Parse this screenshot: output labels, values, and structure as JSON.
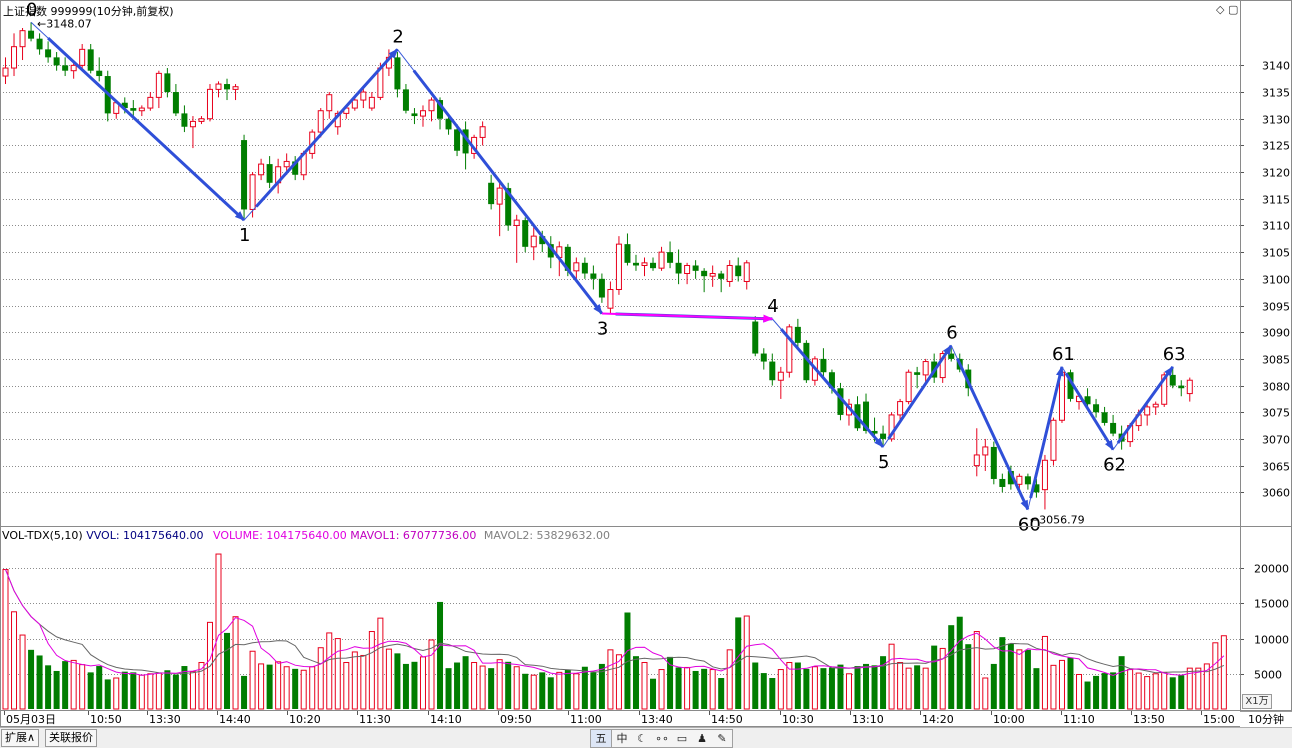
{
  "title": "上证指数 999999(10分钟,前复权)",
  "window_icons": "◇ ▢",
  "volume_header": {
    "name": "VOL-TDX(5,10)",
    "vvol": "VVOL: 104175640.00",
    "volume": "VOLUME: 104175640.00",
    "mavol1": "MAVOL1: 67077736.00",
    "mavol2": "MAVOL2: 53829632.00"
  },
  "bottom_tabs": [
    "扩展∧",
    "关联报价"
  ],
  "toolbar_icons": [
    "五",
    "中",
    "moon-icon",
    "glasses-icon",
    "keyboard-icon",
    "user-icon",
    "wrench-icon"
  ],
  "toolbar_labels": [
    "五",
    "中",
    "☾",
    "∘∘",
    "▭",
    "♟",
    "✎"
  ],
  "period_label": "10分钟",
  "zoom_label": "X1万",
  "colors": {
    "up": "#e8001c",
    "down": "#007d00",
    "wave": "#3a5bd9",
    "wave_arrow": "#2f4fd8",
    "magenta": "#ff00ff",
    "grid": "#8c8c8c",
    "ma1": "#e100e1",
    "ma2": "#666666"
  },
  "chart_data": [
    {
      "type": "candlestick",
      "title": "上证指数 999999(10分钟,前复权)",
      "price_axis": {
        "ticks": [
          3060,
          3065,
          3070,
          3075,
          3080,
          3085,
          3090,
          3095,
          3100,
          3105,
          3110,
          3115,
          3120,
          3125,
          3130,
          3135,
          3140
        ],
        "range": [
          3053.5,
          3148.5
        ]
      },
      "time_axis_labels": [
        "05月03日",
        "10:50",
        "13:30",
        "14:40",
        "10:20",
        "11:30",
        "14:10",
        "09:50",
        "11:00",
        "13:40",
        "14:50",
        "10:30",
        "13:10",
        "14:20",
        "10:00",
        "11:10",
        "13:50",
        "15:00"
      ],
      "max_marker": {
        "label": "3148.07",
        "value": 3148.07
      },
      "min_marker": {
        "label": "3056.79",
        "value": 3056.79
      },
      "candles": [
        [
          3138.0,
          3141.5,
          3136.5,
          3139.5
        ],
        [
          3139.5,
          3146.0,
          3138.0,
          3143.5
        ],
        [
          3143.5,
          3147.0,
          3141.0,
          3146.5
        ],
        [
          3146.5,
          3148.07,
          3144.5,
          3145.0
        ],
        [
          3145.0,
          3146.0,
          3142.0,
          3143.0
        ],
        [
          3143.0,
          3144.5,
          3140.5,
          3141.5
        ],
        [
          3141.5,
          3142.5,
          3139.0,
          3140.0
        ],
        [
          3140.0,
          3141.5,
          3138.0,
          3139.0
        ],
        [
          3139.0,
          3140.5,
          3137.5,
          3140.0
        ],
        [
          3140.0,
          3144.0,
          3139.0,
          3143.0
        ],
        [
          3143.0,
          3144.0,
          3138.5,
          3139.0
        ],
        [
          3139.0,
          3141.5,
          3137.0,
          3138.0
        ],
        [
          3138.0,
          3139.0,
          3129.5,
          3131.0
        ],
        [
          3131.0,
          3133.5,
          3130.0,
          3133.0
        ],
        [
          3133.0,
          3134.0,
          3131.0,
          3132.0
        ],
        [
          3132.0,
          3133.5,
          3130.5,
          3131.5
        ],
        [
          3131.5,
          3132.5,
          3130.5,
          3132.0
        ],
        [
          3132.0,
          3135.0,
          3131.5,
          3134.0
        ],
        [
          3134.0,
          3139.0,
          3132.0,
          3138.5
        ],
        [
          3138.5,
          3139.5,
          3134.0,
          3135.0
        ],
        [
          3135.0,
          3136.5,
          3130.5,
          3131.0
        ],
        [
          3131.0,
          3132.5,
          3127.5,
          3128.5
        ],
        [
          3128.5,
          3130.5,
          3124.5,
          3129.5
        ],
        [
          3129.5,
          3130.5,
          3129.0,
          3130.0
        ],
        [
          3130.0,
          3136.5,
          3129.5,
          3135.5
        ],
        [
          3135.5,
          3137.0,
          3134.0,
          3136.5
        ],
        [
          3136.5,
          3137.5,
          3133.5,
          3135.5
        ],
        [
          3135.5,
          3136.5,
          3133.5,
          3136.0
        ],
        [
          3126.0,
          3127.0,
          3111.0,
          3113.0
        ],
        [
          3113.0,
          3120.0,
          3111.5,
          3119.5
        ],
        [
          3119.5,
          3122.5,
          3118.5,
          3121.5
        ],
        [
          3121.5,
          3123.0,
          3117.0,
          3118.0
        ],
        [
          3118.0,
          3122.5,
          3116.0,
          3121.0
        ],
        [
          3121.0,
          3123.5,
          3119.5,
          3122.0
        ],
        [
          3122.0,
          3123.0,
          3118.5,
          3119.5
        ],
        [
          3119.5,
          3124.0,
          3118.5,
          3123.5
        ],
        [
          3123.5,
          3128.0,
          3122.5,
          3127.5
        ],
        [
          3127.5,
          3132.0,
          3126.5,
          3131.5
        ],
        [
          3131.5,
          3135.0,
          3130.0,
          3134.5
        ],
        [
          3128.5,
          3131.5,
          3127.0,
          3131.0
        ],
        [
          3131.0,
          3132.5,
          3130.0,
          3132.0
        ],
        [
          3132.0,
          3134.0,
          3131.5,
          3133.5
        ],
        [
          3133.5,
          3136.0,
          3132.0,
          3135.0
        ],
        [
          3132.0,
          3135.0,
          3131.5,
          3134.0
        ],
        [
          3134.0,
          3140.5,
          3133.5,
          3139.5
        ],
        [
          3139.5,
          3143.0,
          3138.0,
          3141.5
        ],
        [
          3141.5,
          3142.5,
          3134.0,
          3135.5
        ],
        [
          3135.5,
          3136.5,
          3131.0,
          3131.5
        ],
        [
          3131.0,
          3132.0,
          3129.0,
          3130.5
        ],
        [
          3130.5,
          3132.5,
          3128.5,
          3131.5
        ],
        [
          3131.5,
          3134.0,
          3129.5,
          3133.5
        ],
        [
          3133.5,
          3134.0,
          3128.0,
          3130.0
        ],
        [
          3130.0,
          3130.5,
          3127.0,
          3128.0
        ],
        [
          3128.0,
          3129.0,
          3123.0,
          3124.0
        ],
        [
          3128.0,
          3129.5,
          3120.5,
          3123.5
        ],
        [
          3123.5,
          3127.0,
          3122.5,
          3126.5
        ],
        [
          3126.5,
          3129.5,
          3125.0,
          3128.5
        ],
        [
          3118.0,
          3119.5,
          3113.0,
          3114.0
        ],
        [
          3114.0,
          3118.0,
          3108.0,
          3117.0
        ],
        [
          3117.0,
          3118.0,
          3109.0,
          3110.0
        ],
        [
          3110.0,
          3112.0,
          3103.0,
          3111.0
        ],
        [
          3111.0,
          3111.5,
          3105.0,
          3106.0
        ],
        [
          3106.0,
          3110.0,
          3103.5,
          3108.0
        ],
        [
          3108.0,
          3109.0,
          3105.0,
          3106.5
        ],
        [
          3106.5,
          3108.0,
          3102.0,
          3104.0
        ],
        [
          3104.0,
          3107.0,
          3100.5,
          3106.0
        ],
        [
          3106.0,
          3106.5,
          3100.5,
          3101.5
        ],
        [
          3101.5,
          3104.0,
          3099.5,
          3103.0
        ],
        [
          3103.0,
          3104.0,
          3100.0,
          3101.0
        ],
        [
          3101.0,
          3102.5,
          3098.0,
          3100.0
        ],
        [
          3100.0,
          3101.0,
          3095.5,
          3096.5
        ],
        [
          3094.5,
          3099.5,
          3093.5,
          3098.0
        ],
        [
          3098.0,
          3108.0,
          3097.0,
          3106.5
        ],
        [
          3106.5,
          3108.5,
          3102.5,
          3103.0
        ],
        [
          3103.0,
          3104.5,
          3101.5,
          3102.5
        ],
        [
          3102.5,
          3104.0,
          3100.5,
          3103.0
        ],
        [
          3103.0,
          3104.0,
          3101.5,
          3102.0
        ],
        [
          3102.0,
          3106.0,
          3101.5,
          3105.0
        ],
        [
          3105.0,
          3107.0,
          3102.0,
          3103.0
        ],
        [
          3103.0,
          3105.5,
          3099.0,
          3101.0
        ],
        [
          3101.0,
          3103.0,
          3099.0,
          3102.5
        ],
        [
          3102.5,
          3103.5,
          3100.0,
          3101.5
        ],
        [
          3101.5,
          3102.0,
          3097.5,
          3100.5
        ],
        [
          3100.5,
          3102.5,
          3098.5,
          3101.0
        ],
        [
          3101.0,
          3101.5,
          3097.5,
          3100.0
        ],
        [
          3099.5,
          3103.5,
          3098.5,
          3102.5
        ],
        [
          3102.5,
          3104.0,
          3099.5,
          3100.5
        ],
        [
          3099.5,
          3103.5,
          3098.0,
          3103.0
        ],
        [
          3092.0,
          3093.0,
          3085.5,
          3086.0
        ],
        [
          3086.0,
          3087.0,
          3083.0,
          3084.5
        ],
        [
          3084.5,
          3086.0,
          3080.0,
          3081.0
        ],
        [
          3081.0,
          3083.5,
          3077.5,
          3082.5
        ],
        [
          3082.5,
          3091.5,
          3081.5,
          3091.0
        ],
        [
          3091.0,
          3092.5,
          3087.0,
          3088.0
        ],
        [
          3088.0,
          3088.5,
          3080.5,
          3081.0
        ],
        [
          3081.0,
          3085.5,
          3080.0,
          3085.0
        ],
        [
          3085.0,
          3087.0,
          3081.5,
          3082.5
        ],
        [
          3082.5,
          3083.0,
          3078.5,
          3079.5
        ],
        [
          3079.5,
          3080.5,
          3073.5,
          3074.5
        ],
        [
          3074.5,
          3077.5,
          3072.5,
          3076.5
        ],
        [
          3076.5,
          3078.0,
          3071.5,
          3072.0
        ],
        [
          3077.0,
          3078.5,
          3071.0,
          3071.5
        ],
        [
          3071.5,
          3074.0,
          3069.5,
          3071.0
        ],
        [
          3071.0,
          3072.5,
          3068.5,
          3070.0
        ],
        [
          3070.0,
          3075.0,
          3069.5,
          3074.5
        ],
        [
          3074.5,
          3077.5,
          3073.5,
          3077.0
        ],
        [
          3077.0,
          3083.0,
          3076.5,
          3082.5
        ],
        [
          3082.5,
          3083.5,
          3079.5,
          3082.0
        ],
        [
          3082.0,
          3085.0,
          3080.5,
          3084.5
        ],
        [
          3084.5,
          3086.0,
          3080.5,
          3081.5
        ],
        [
          3081.5,
          3086.5,
          3080.5,
          3086.0
        ],
        [
          3086.0,
          3087.5,
          3084.5,
          3085.0
        ],
        [
          3085.0,
          3086.0,
          3082.5,
          3083.0
        ],
        [
          3083.0,
          3084.0,
          3078.0,
          3079.5
        ],
        [
          3065.0,
          3072.0,
          3063.0,
          3067.0
        ],
        [
          3067.0,
          3070.0,
          3064.0,
          3068.5
        ],
        [
          3068.5,
          3069.5,
          3061.5,
          3062.5
        ],
        [
          3062.5,
          3063.5,
          3060.0,
          3061.0
        ],
        [
          3064.0,
          3065.0,
          3060.5,
          3061.5
        ],
        [
          3061.5,
          3063.5,
          3060.0,
          3063.0
        ],
        [
          3063.0,
          3063.5,
          3060.5,
          3061.5
        ],
        [
          3061.5,
          3062.5,
          3059.0,
          3060.0
        ],
        [
          3060.5,
          3067.0,
          3056.79,
          3066.0
        ],
        [
          3066.0,
          3074.0,
          3065.0,
          3073.5
        ],
        [
          3073.5,
          3083.5,
          3073.0,
          3082.5
        ],
        [
          3082.5,
          3083.0,
          3077.0,
          3077.5
        ],
        [
          3077.0,
          3078.5,
          3075.5,
          3078.0
        ],
        [
          3078.0,
          3079.5,
          3075.5,
          3076.5
        ],
        [
          3076.5,
          3077.5,
          3074.0,
          3075.0
        ],
        [
          3075.0,
          3076.0,
          3072.5,
          3073.0
        ],
        [
          3073.0,
          3074.5,
          3070.5,
          3071.0
        ],
        [
          3071.0,
          3072.5,
          3068.0,
          3069.5
        ],
        [
          3069.5,
          3073.0,
          3068.5,
          3072.5
        ],
        [
          3072.5,
          3075.5,
          3071.5,
          3074.5
        ],
        [
          3074.5,
          3076.5,
          3072.5,
          3076.0
        ],
        [
          3076.0,
          3077.0,
          3074.5,
          3076.5
        ],
        [
          3076.5,
          3082.5,
          3076.0,
          3082.0
        ],
        [
          3082.0,
          3083.5,
          3079.5,
          3080.0
        ],
        [
          3080.0,
          3081.0,
          3078.0,
          3079.5
        ],
        [
          3078.5,
          3081.5,
          3077.0,
          3081.0
        ]
      ],
      "waves": [
        {
          "label": "0",
          "value": 3148.07
        },
        {
          "label": "1",
          "value": 3111.0
        },
        {
          "label": "2",
          "value": 3143.0
        },
        {
          "label": "3",
          "value": 3093.5
        },
        {
          "label": "4",
          "value": 3092.5
        },
        {
          "label": "5",
          "value": 3068.5
        },
        {
          "label": "6",
          "value": 3087.5
        },
        {
          "label": "60",
          "value": 3056.79
        },
        {
          "label": "61",
          "value": 3083.5
        },
        {
          "label": "62",
          "value": 3068.0
        },
        {
          "label": "63",
          "value": 3083.5
        }
      ]
    },
    {
      "type": "bar",
      "title": "VOL-TDX(5,10)",
      "y_axis": {
        "ticks": [
          5000,
          10000,
          15000,
          20000
        ],
        "unit_label": "X1万",
        "range": [
          0,
          23000
        ]
      },
      "series": [
        {
          "name": "VOLUME",
          "values": [
            19800,
            13800,
            10500,
            8400,
            7600,
            6200,
            5400,
            6800,
            6900,
            6300,
            5200,
            6100,
            4200,
            4400,
            5300,
            5200,
            4800,
            5000,
            5100,
            5500,
            4900,
            6100,
            5300,
            6600,
            12300,
            22000,
            10800,
            13100,
            4700,
            8200,
            6400,
            6300,
            6700,
            6000,
            5700,
            5500,
            6000,
            8700,
            10800,
            10000,
            6600,
            8100,
            7600,
            11000,
            12900,
            8500,
            7900,
            6400,
            6700,
            7400,
            9800,
            15200,
            5800,
            6600,
            7500,
            6600,
            6100,
            5800,
            7000,
            6700,
            6000,
            5000,
            4800,
            5200,
            4500,
            5200,
            5600,
            5000,
            6000,
            5200,
            6400,
            8400,
            7700,
            13700,
            7500,
            6600,
            4300,
            5600,
            7400,
            5900,
            5900,
            5400,
            5700,
            5600,
            4400,
            8400,
            13000,
            13200,
            6600,
            5100,
            4400,
            5600,
            6600,
            6600,
            5700,
            6000,
            5800,
            5900,
            6300,
            5000,
            6100,
            6400,
            6200,
            7500,
            9200,
            6600,
            5800,
            6200,
            5800,
            9000,
            8600,
            11900,
            13100,
            9200,
            11000,
            4400,
            6400,
            10200,
            9300,
            8400,
            8400,
            5800,
            10300,
            6200,
            6900,
            7300,
            4900,
            3900,
            4700,
            5100,
            5200,
            7500,
            5600,
            5100,
            4600,
            5000,
            5200,
            4500,
            4800,
            5800,
            5800,
            6400,
            9400,
            10400
          ]
        },
        {
          "name": "MAVOL1"
        },
        {
          "name": "MAVOL2"
        }
      ]
    }
  ]
}
